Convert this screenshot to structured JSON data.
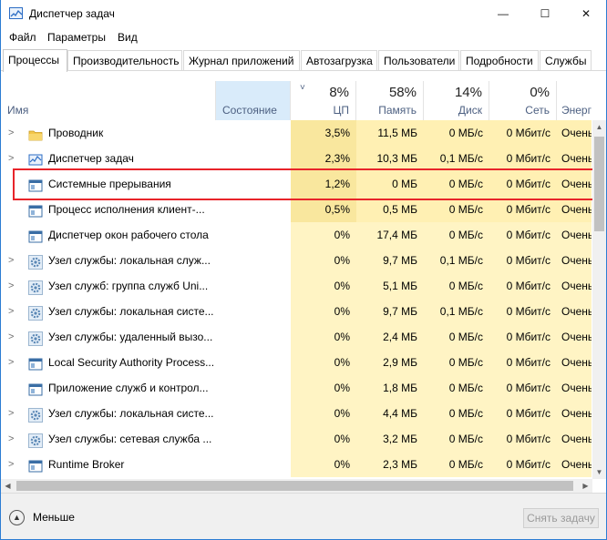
{
  "window": {
    "title": "Диспетчер задач"
  },
  "window_controls": {
    "minimize": "—",
    "maximize": "☐",
    "close": "✕"
  },
  "menu": [
    "Файл",
    "Параметры",
    "Вид"
  ],
  "tabs": [
    "Процессы",
    "Производительность",
    "Журнал приложений",
    "Автозагрузка",
    "Пользователи",
    "Подробности",
    "Службы"
  ],
  "active_tab": "Процессы",
  "columns": {
    "name": {
      "label": "Имя"
    },
    "state": {
      "label": "Состояние"
    },
    "cpu": {
      "label": "ЦП",
      "pct": "8%"
    },
    "memory": {
      "label": "Память",
      "pct": "58%"
    },
    "disk": {
      "label": "Диск",
      "pct": "14%"
    },
    "network": {
      "label": "Сеть",
      "pct": "0%"
    },
    "power": {
      "label": "Энергоп"
    }
  },
  "sort_indicator": "˅",
  "processes": [
    {
      "name": "Проводник",
      "expandable": true,
      "icon": "folder-icon",
      "cpu": "3,5%",
      "memory": "11,5 МБ",
      "disk": "0 МБ/с",
      "network": "0 Мбит/с",
      "power": "Очень",
      "heat": "med"
    },
    {
      "name": "Диспетчер задач",
      "expandable": true,
      "icon": "task-manager-icon",
      "cpu": "2,3%",
      "memory": "10,3 МБ",
      "disk": "0,1 МБ/с",
      "network": "0 Мбит/с",
      "power": "Очень",
      "heat": "med"
    },
    {
      "name": "Системные прерывания",
      "expandable": false,
      "icon": "window-app-icon",
      "cpu": "1,2%",
      "memory": "0 МБ",
      "disk": "0 МБ/с",
      "network": "0 Мбит/с",
      "power": "Очень",
      "heat": "med"
    },
    {
      "name": "Процесс исполнения клиент-...",
      "expandable": false,
      "icon": "window-app-icon",
      "cpu": "0,5%",
      "memory": "0,5 МБ",
      "disk": "0 МБ/с",
      "network": "0 Мбит/с",
      "power": "Очень",
      "heat": "med"
    },
    {
      "name": "Диспетчер окон рабочего стола",
      "expandable": false,
      "icon": "window-app-icon",
      "cpu": "0%",
      "memory": "17,4 МБ",
      "disk": "0 МБ/с",
      "network": "0 Мбит/с",
      "power": "Очень",
      "heat": "low"
    },
    {
      "name": "Узел службы: локальная служ...",
      "expandable": true,
      "icon": "service-gear-icon",
      "cpu": "0%",
      "memory": "9,7 МБ",
      "disk": "0,1 МБ/с",
      "network": "0 Мбит/с",
      "power": "Очень",
      "heat": "low"
    },
    {
      "name": "Узел служб: группа служб Uni...",
      "expandable": true,
      "icon": "service-gear-icon",
      "cpu": "0%",
      "memory": "5,1 МБ",
      "disk": "0 МБ/с",
      "network": "0 Мбит/с",
      "power": "Очень",
      "heat": "low"
    },
    {
      "name": "Узел службы: локальная систе...",
      "expandable": true,
      "icon": "service-gear-icon",
      "cpu": "0%",
      "memory": "9,7 МБ",
      "disk": "0,1 МБ/с",
      "network": "0 Мбит/с",
      "power": "Очень",
      "heat": "low"
    },
    {
      "name": "Узел службы: удаленный вызо...",
      "expandable": true,
      "icon": "service-gear-icon",
      "cpu": "0%",
      "memory": "2,4 МБ",
      "disk": "0 МБ/с",
      "network": "0 Мбит/с",
      "power": "Очень",
      "heat": "low"
    },
    {
      "name": "Local Security Authority Process...",
      "expandable": true,
      "icon": "window-app-icon",
      "cpu": "0%",
      "memory": "2,9 МБ",
      "disk": "0 МБ/с",
      "network": "0 Мбит/с",
      "power": "Очень",
      "heat": "low"
    },
    {
      "name": "Приложение служб и контрол...",
      "expandable": false,
      "icon": "window-app-icon",
      "cpu": "0%",
      "memory": "1,8 МБ",
      "disk": "0 МБ/с",
      "network": "0 Мбит/с",
      "power": "Очень",
      "heat": "low"
    },
    {
      "name": "Узел службы: локальная систе...",
      "expandable": true,
      "icon": "service-gear-icon",
      "cpu": "0%",
      "memory": "4,4 МБ",
      "disk": "0 МБ/с",
      "network": "0 Мбит/с",
      "power": "Очень",
      "heat": "low"
    },
    {
      "name": "Узел службы: сетевая служба ...",
      "expandable": true,
      "icon": "service-gear-icon",
      "cpu": "0%",
      "memory": "3,2 МБ",
      "disk": "0 МБ/с",
      "network": "0 Мбит/с",
      "power": "Очень",
      "heat": "low"
    },
    {
      "name": "Runtime Broker",
      "expandable": true,
      "icon": "window-app-icon",
      "cpu": "0%",
      "memory": "2,3 МБ",
      "disk": "0 МБ/с",
      "network": "0 Мбит/с",
      "power": "Очень",
      "heat": "low"
    }
  ],
  "highlighted_process": "Системные прерывания",
  "footer": {
    "less_label": "Меньше",
    "end_task_label": "Снять задачу"
  },
  "colors": {
    "heat_med": "#fff0b3",
    "heat_low": "#fff4c4",
    "cpu_heat_med": "#f9e79e",
    "cpu_heat_low": "#fff4c4",
    "sorted_header": "#d9ebfa",
    "highlight_border": "#e8242a",
    "window_border": "#2b7cd3"
  }
}
